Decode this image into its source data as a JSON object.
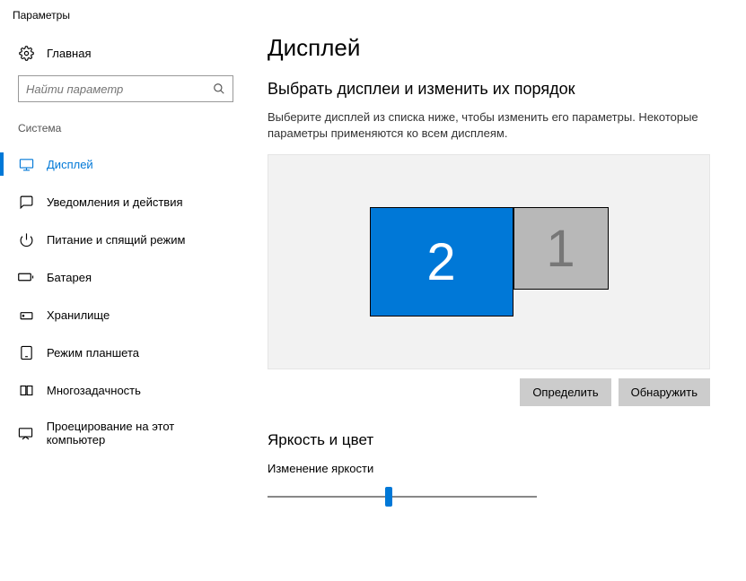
{
  "window": {
    "title": "Параметры"
  },
  "sidebar": {
    "home": "Главная",
    "search_placeholder": "Найти параметр",
    "section": "Система",
    "items": [
      {
        "label": "Дисплей"
      },
      {
        "label": "Уведомления и действия"
      },
      {
        "label": "Питание и спящий режим"
      },
      {
        "label": "Батарея"
      },
      {
        "label": "Хранилище"
      },
      {
        "label": "Режим планшета"
      },
      {
        "label": "Многозадачность"
      },
      {
        "label": "Проецирование на этот компьютер"
      }
    ]
  },
  "main": {
    "title": "Дисплей",
    "arrange_heading": "Выбрать дисплеи и изменить их порядок",
    "arrange_desc": "Выберите дисплей из списка ниже, чтобы изменить его параметры. Некоторые параметры применяются ко всем дисплеям.",
    "displays": {
      "primary": "2",
      "secondary": "1"
    },
    "identify_btn": "Определить",
    "detect_btn": "Обнаружить",
    "brightness_heading": "Яркость и цвет",
    "brightness_label": "Изменение яркости"
  }
}
